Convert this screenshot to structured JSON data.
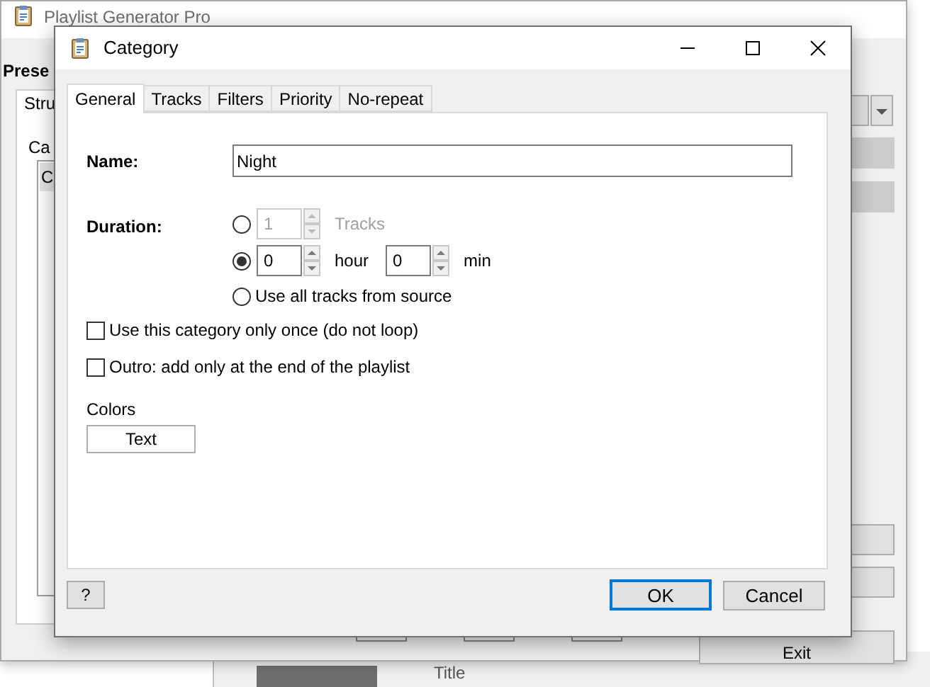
{
  "background_window": {
    "title": "Playlist Generator Pro",
    "heading": "Prese",
    "tab": "Stru",
    "list_label": "Ca",
    "list_header": "C",
    "exit_button": "Exit"
  },
  "lower_window": {
    "column_header": "Title"
  },
  "dialog": {
    "title": "Category",
    "tabs": [
      {
        "label": "General",
        "selected": true
      },
      {
        "label": "Tracks",
        "selected": false
      },
      {
        "label": "Filters",
        "selected": false
      },
      {
        "label": "Priority",
        "selected": false
      },
      {
        "label": "No-repeat",
        "selected": false
      }
    ],
    "name_label": "Name:",
    "name_value": "Night",
    "duration_label": "Duration:",
    "duration_options": [
      {
        "kind": "tracks",
        "selected": false,
        "disabled": true,
        "value": "1",
        "unit": "Tracks"
      },
      {
        "kind": "time",
        "selected": true,
        "disabled": false,
        "hours": "0",
        "hour_unit": "hour",
        "minutes": "0",
        "minute_unit": "min"
      },
      {
        "kind": "all",
        "selected": false,
        "disabled": false,
        "label": "Use all tracks from source"
      }
    ],
    "checkboxes": [
      {
        "label": "Use this category only once (do not loop)",
        "checked": false
      },
      {
        "label": "Outro: add only at the end of the playlist",
        "checked": false
      }
    ],
    "colors_label": "Colors",
    "color_button": "Text",
    "help_button": "?",
    "ok_button": "OK",
    "cancel_button": "Cancel"
  }
}
